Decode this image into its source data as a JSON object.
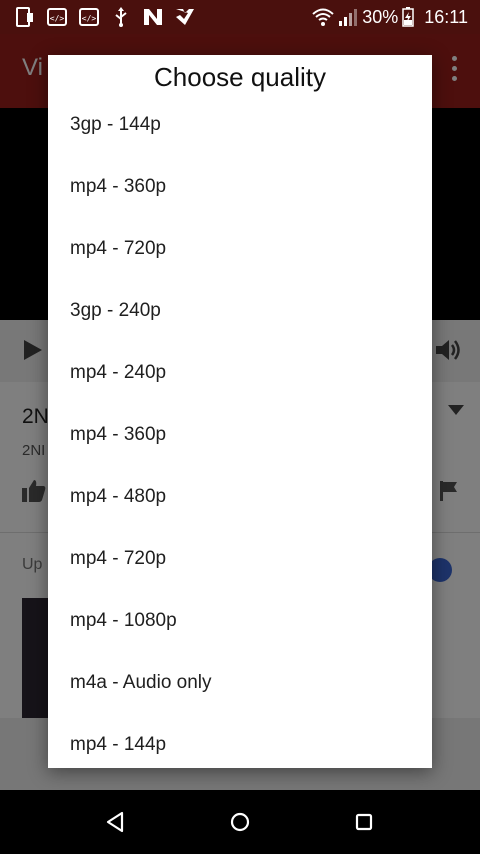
{
  "status_bar": {
    "battery_percent": "30%",
    "time": "16:11",
    "left_icons": [
      "screen-record-icon",
      "code-icon",
      "code-icon",
      "usb-icon",
      "n-app-icon",
      "check-app-icon"
    ]
  },
  "app_bar": {
    "title_fragment": "Vi"
  },
  "background_content": {
    "video_title_fragment": "2N",
    "channel_fragment": "2NI",
    "up_next_fragment": "Up"
  },
  "dialog": {
    "title": "Choose quality",
    "options": [
      "3gp - 144p",
      "mp4 - 360p",
      "mp4 - 720p",
      "3gp - 240p",
      "mp4 - 240p",
      "mp4 - 360p",
      "mp4 - 480p",
      "mp4 - 720p",
      "mp4 - 1080p",
      "m4a - Audio only",
      "mp4 - 144p"
    ]
  },
  "nav_bar": {
    "buttons": [
      "back-icon",
      "home-icon",
      "recents-icon"
    ]
  },
  "colors": {
    "app_primary": "#9a1f1a",
    "status_bar": "#7a1a16",
    "toggle_accent": "#3b67d4"
  }
}
